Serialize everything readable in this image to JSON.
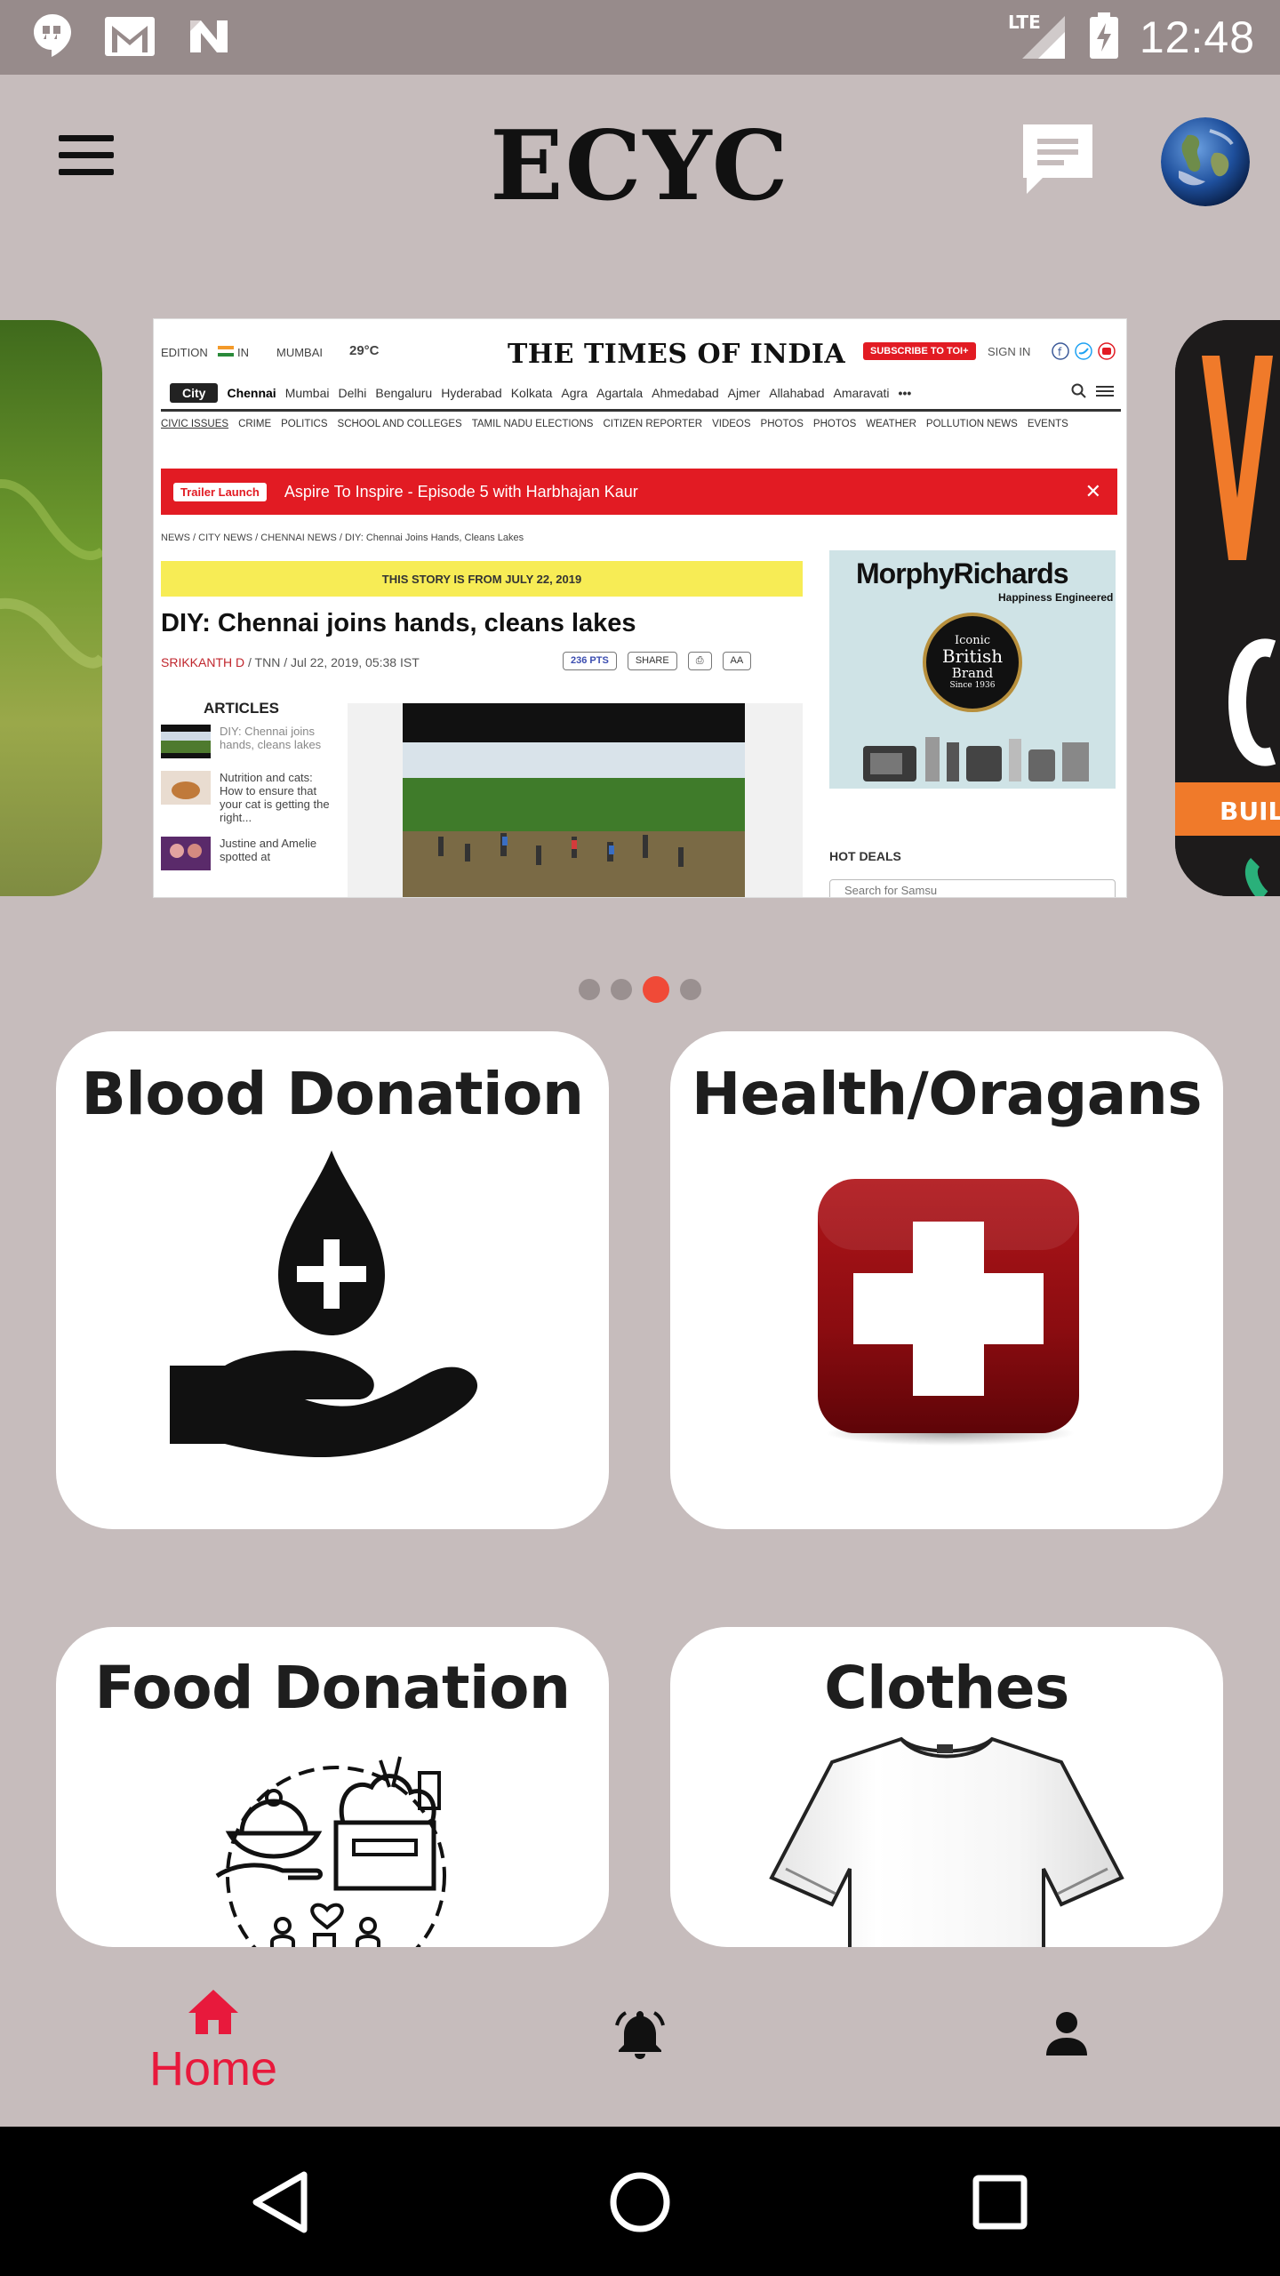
{
  "status_bar": {
    "time": "12:48",
    "network": "LTE",
    "icons": [
      "hangouts-icon",
      "gmail-icon",
      "n-icon",
      "signal-icon",
      "battery-charging-icon"
    ]
  },
  "app_bar": {
    "title": "ECYC",
    "menu_icon": "menu-icon",
    "chat_icon": "chat-icon",
    "avatar_icon": "globe-avatar"
  },
  "carousel": {
    "active_index": 2,
    "slide_count": 4,
    "article": {
      "edition_label": "EDITION",
      "edition_value": "IN",
      "city": "MUMBAI",
      "temp": "29°C",
      "logo": "THE TIMES OF INDIA",
      "subscribe": "SUBSCRIBE TO TOI+",
      "sign_in": "SIGN IN",
      "city_tag": "City",
      "nav_cities": [
        "Chennai",
        "Mumbai",
        "Delhi",
        "Bengaluru",
        "Hyderabad",
        "Kolkata",
        "Agra",
        "Agartala",
        "Ahmedabad",
        "Ajmer",
        "Allahabad",
        "Amaravati",
        "•••"
      ],
      "sections": [
        "CIVIC ISSUES",
        "CRIME",
        "POLITICS",
        "SCHOOL AND COLLEGES",
        "TAMIL NADU ELECTIONS",
        "CITIZEN REPORTER",
        "VIDEOS",
        "PHOTOS",
        "PHOTOS",
        "WEATHER",
        "POLLUTION NEWS",
        "EVENTS"
      ],
      "trailer_badge": "Trailer Launch",
      "trailer_text": "Aspire To Inspire - Episode 5 with Harbhajan Kaur",
      "breadcrumb": "NEWS  /  CITY NEWS  /  CHENNAI NEWS  /  DIY: Chennai Joins Hands, Cleans Lakes",
      "story_note": "THIS STORY IS FROM JULY 22, 2019",
      "headline": "DIY: Chennai joins hands, cleans lakes",
      "author": "SRIKKANTH D",
      "byline_rest": " / TNN / Jul 22, 2019, 05:38 IST",
      "points": "236 PTS",
      "share": "SHARE",
      "font_size": "AA",
      "articles_heading": "ARTICLES",
      "articles": [
        "DIY: Chennai joins hands, cleans lakes",
        "Nutrition and cats: How to ensure that your cat is getting the right...",
        "Justine and Amelie spotted at"
      ],
      "ad_brand": "MorphyRichards",
      "ad_tagline": "Happiness Engineered",
      "ad_seal_line1": "Iconic",
      "ad_seal_line2": "British",
      "ad_seal_line3": "Brand",
      "ad_seal_line4": "Since 1936",
      "hot_deals": "HOT DEALS",
      "search_placeholder": "Search for Samsu"
    }
  },
  "cards": [
    {
      "title": "Blood Donation",
      "icon": "blood-donation-icon"
    },
    {
      "title": "Health/Oragans",
      "icon": "medical-cross-icon"
    },
    {
      "title": "Food Donation",
      "icon": "food-donation-icon"
    },
    {
      "title": "Clothes",
      "icon": "tshirt-icon"
    }
  ],
  "bottom_nav": {
    "home_label": "Home",
    "active": "home",
    "accent": "#e8193c"
  },
  "colors": {
    "background": "#c6bcbc",
    "status_bar": "#978b8b",
    "active_dot": "#f04a37"
  }
}
